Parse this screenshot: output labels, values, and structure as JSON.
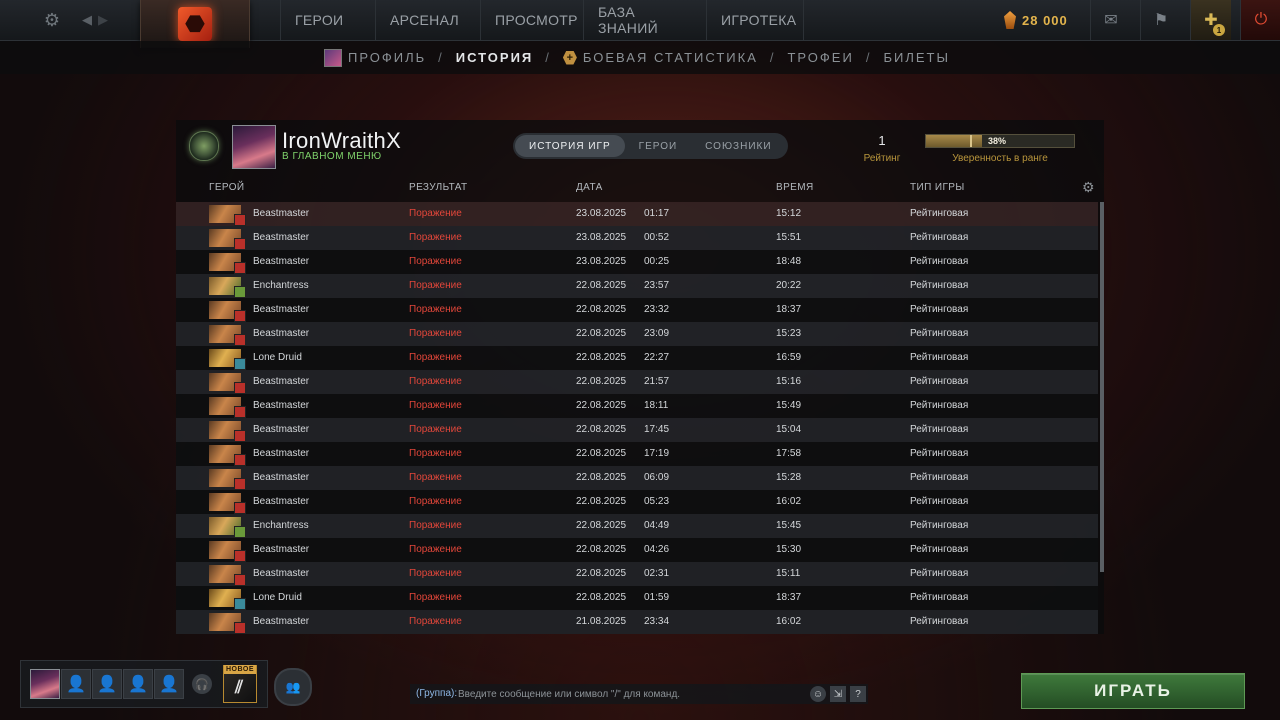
{
  "topbar": {
    "nav": [
      "ГЕРОИ",
      "АРСЕНАЛ",
      "ПРОСМОТР",
      "БАЗА ЗНАНИЙ",
      "ИГРОТЕКА"
    ],
    "shards": "28 000",
    "quest_badge": "1"
  },
  "subnav": {
    "items": [
      "ПРОФИЛЬ",
      "ИСТОРИЯ",
      "БОЕВАЯ СТАТИСТИКА",
      "ТРОФЕИ",
      "БИЛЕТЫ"
    ],
    "active": "ИСТОРИЯ"
  },
  "profile": {
    "name": "IronWraithX",
    "status": "В ГЛАВНОМ МЕНЮ",
    "rating_value": "1",
    "rating_label": "Рейтинг",
    "confidence_pct": "38%",
    "confidence_fraction": 0.38,
    "confidence_label": "Уверенность в ранге"
  },
  "tabs": [
    "ИСТОРИЯ ИГР",
    "ГЕРОИ",
    "СОЮЗНИКИ"
  ],
  "table": {
    "headers": {
      "hero": "ГЕРОЙ",
      "result": "РЕЗУЛЬТАТ",
      "date": "ДАТА",
      "duration": "ВРЕМЯ",
      "game_type": "ТИП ИГРЫ"
    },
    "rows": [
      {
        "hero": "Beastmaster",
        "result": "Поражение",
        "date": "23.08.2025",
        "time": "01:17",
        "duration": "15:12",
        "type": "Рейтинговая"
      },
      {
        "hero": "Beastmaster",
        "result": "Поражение",
        "date": "23.08.2025",
        "time": "00:52",
        "duration": "15:51",
        "type": "Рейтинговая"
      },
      {
        "hero": "Beastmaster",
        "result": "Поражение",
        "date": "23.08.2025",
        "time": "00:25",
        "duration": "18:48",
        "type": "Рейтинговая"
      },
      {
        "hero": "Enchantress",
        "result": "Поражение",
        "date": "22.08.2025",
        "time": "23:57",
        "duration": "20:22",
        "type": "Рейтинговая"
      },
      {
        "hero": "Beastmaster",
        "result": "Поражение",
        "date": "22.08.2025",
        "time": "23:32",
        "duration": "18:37",
        "type": "Рейтинговая"
      },
      {
        "hero": "Beastmaster",
        "result": "Поражение",
        "date": "22.08.2025",
        "time": "23:09",
        "duration": "15:23",
        "type": "Рейтинговая"
      },
      {
        "hero": "Lone Druid",
        "result": "Поражение",
        "date": "22.08.2025",
        "time": "22:27",
        "duration": "16:59",
        "type": "Рейтинговая"
      },
      {
        "hero": "Beastmaster",
        "result": "Поражение",
        "date": "22.08.2025",
        "time": "21:57",
        "duration": "15:16",
        "type": "Рейтинговая"
      },
      {
        "hero": "Beastmaster",
        "result": "Поражение",
        "date": "22.08.2025",
        "time": "18:11",
        "duration": "15:49",
        "type": "Рейтинговая"
      },
      {
        "hero": "Beastmaster",
        "result": "Поражение",
        "date": "22.08.2025",
        "time": "17:45",
        "duration": "15:04",
        "type": "Рейтинговая"
      },
      {
        "hero": "Beastmaster",
        "result": "Поражение",
        "date": "22.08.2025",
        "time": "17:19",
        "duration": "17:58",
        "type": "Рейтинговая"
      },
      {
        "hero": "Beastmaster",
        "result": "Поражение",
        "date": "22.08.2025",
        "time": "06:09",
        "duration": "15:28",
        "type": "Рейтинговая"
      },
      {
        "hero": "Beastmaster",
        "result": "Поражение",
        "date": "22.08.2025",
        "time": "05:23",
        "duration": "16:02",
        "type": "Рейтинговая"
      },
      {
        "hero": "Enchantress",
        "result": "Поражение",
        "date": "22.08.2025",
        "time": "04:49",
        "duration": "15:45",
        "type": "Рейтинговая"
      },
      {
        "hero": "Beastmaster",
        "result": "Поражение",
        "date": "22.08.2025",
        "time": "04:26",
        "duration": "15:30",
        "type": "Рейтинговая"
      },
      {
        "hero": "Beastmaster",
        "result": "Поражение",
        "date": "22.08.2025",
        "time": "02:31",
        "duration": "15:11",
        "type": "Рейтинговая"
      },
      {
        "hero": "Lone Druid",
        "result": "Поражение",
        "date": "22.08.2025",
        "time": "01:59",
        "duration": "18:37",
        "type": "Рейтинговая"
      },
      {
        "hero": "Beastmaster",
        "result": "Поражение",
        "date": "21.08.2025",
        "time": "23:34",
        "duration": "16:02",
        "type": "Рейтинговая"
      }
    ]
  },
  "bottom": {
    "new_badge": "НОВОЕ",
    "chat_prefix": "(Группа):",
    "chat_placeholder": "Введите сообщение или символ \"/\" для команд.",
    "help_label": "?",
    "play_label": "ИГРАТЬ"
  },
  "colors": {
    "loss": "#e2463a",
    "online": "#7fd36b",
    "gold": "#b9963c",
    "play": "#3f7a3c"
  },
  "icons": {
    "settings": "gear-icon",
    "back": "arrow-left-icon",
    "forward": "arrow-right-icon",
    "mail": "mail-icon",
    "armory": "armory-icon",
    "quest": "quest-icon",
    "power": "power-icon"
  }
}
